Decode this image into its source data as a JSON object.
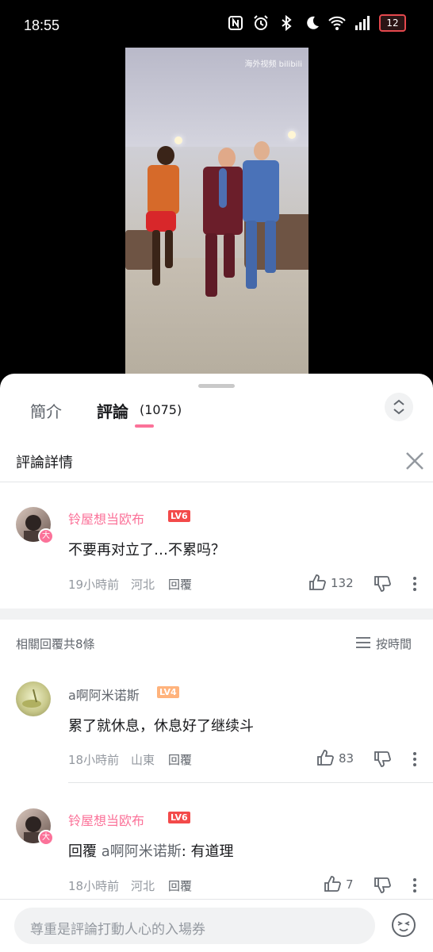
{
  "status_bar": {
    "time": "18:55",
    "battery": "12"
  },
  "video": {
    "watermark": "海外视频 bilibili"
  },
  "tabs": {
    "intro": "簡介",
    "comments": "評論",
    "comment_count": "(1075)"
  },
  "detail": {
    "title": "評論詳情"
  },
  "main_comment": {
    "user": "铃屋想当欧布",
    "level": "LV6",
    "avatar_badge": "大",
    "text": "不要再对立了…不累吗？",
    "time": "19小時前",
    "location": "河北",
    "reply_label": "回覆",
    "likes": "132"
  },
  "related": {
    "label": "相關回覆共8條",
    "sort_label": "按時間"
  },
  "replies": [
    {
      "user": "a啊阿米诺斯",
      "level": "LV4",
      "text": "累了就休息，休息好了继续斗",
      "time": "18小時前",
      "location": "山東",
      "reply_label": "回覆",
      "likes": "83"
    },
    {
      "user": "铃屋想当欧布",
      "level": "LV6",
      "avatar_badge": "大",
      "text_prefix": "回覆",
      "text_mention": "a啊阿米诺斯",
      "text_body": ": 有道理",
      "time": "18小時前",
      "location": "河北",
      "reply_label": "回覆",
      "likes": "7"
    }
  ],
  "input": {
    "placeholder": "尊重是評論打動人心的入場券"
  },
  "colors": {
    "accent": "#fb7299",
    "lv6": "#f34a4a",
    "lv4": "#ffb37c",
    "mention": "#008ac5"
  }
}
